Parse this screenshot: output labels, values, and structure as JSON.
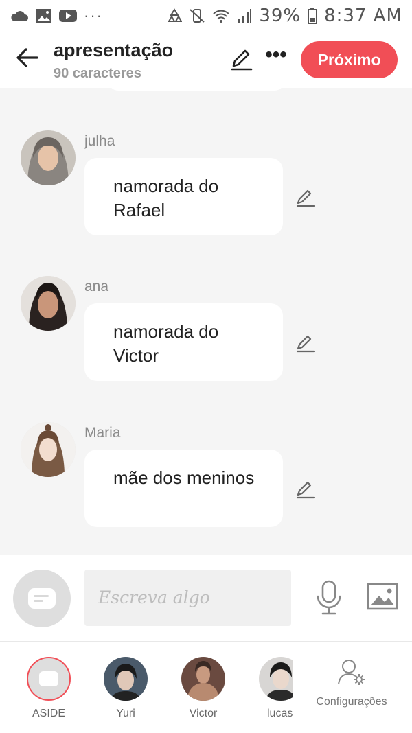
{
  "status_bar": {
    "left_icons": [
      "cloud-icon",
      "image-icon",
      "youtube-icon"
    ],
    "more": "···",
    "battery": "39%",
    "time": "8:37 AM"
  },
  "header": {
    "title": "apresentação",
    "subtitle": "90 caracteres",
    "next_label": "Próximo"
  },
  "messages": [
    {
      "name": "julha",
      "text": "namorada do Rafael"
    },
    {
      "name": "ana",
      "text": "namorada do Victor"
    },
    {
      "name": "Maria",
      "text": "mãe dos meninos"
    }
  ],
  "composer": {
    "placeholder": "Escreva algo"
  },
  "characters": [
    {
      "label": "ASIDE"
    },
    {
      "label": "Yuri"
    },
    {
      "label": "Victor"
    },
    {
      "label": "lucas"
    }
  ],
  "settings": {
    "label": "Configurações"
  },
  "colors": {
    "accent": "#f14e56",
    "background": "#f5f5f5"
  }
}
